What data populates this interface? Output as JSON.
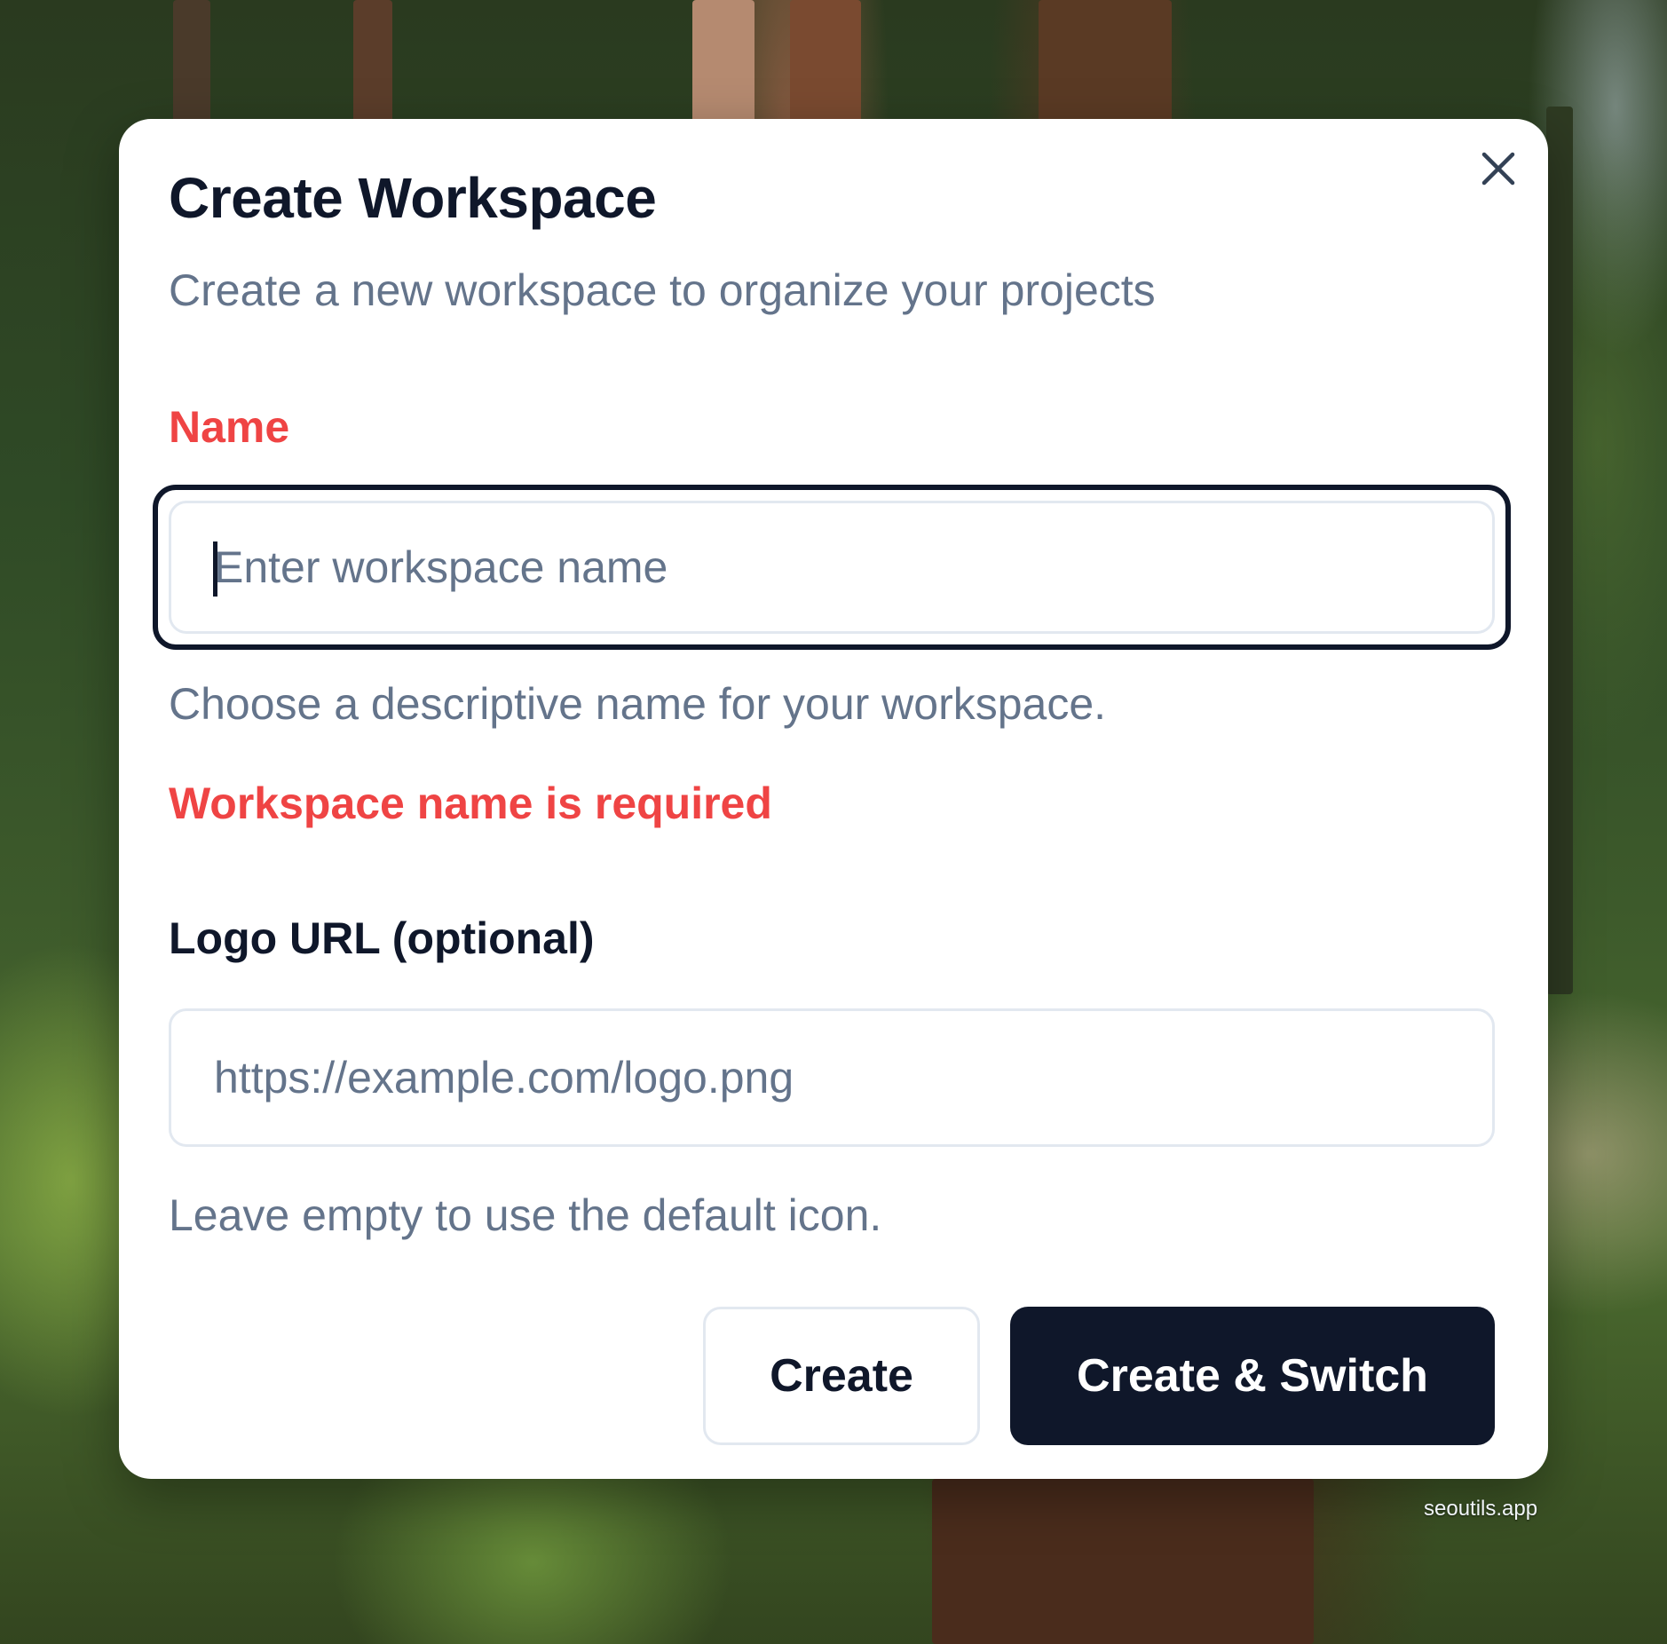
{
  "dialog": {
    "title": "Create Workspace",
    "subtitle": "Create a new workspace to organize your projects",
    "close_icon": "close-icon"
  },
  "name_field": {
    "label": "Name",
    "placeholder": "Enter workspace name",
    "value": "",
    "hint": "Choose a descriptive name for your workspace.",
    "error": "Workspace name is required"
  },
  "logo_field": {
    "label": "Logo URL (optional)",
    "placeholder": "https://example.com/logo.png",
    "value": "",
    "hint": "Leave empty to use the default icon."
  },
  "actions": {
    "create_label": "Create",
    "create_switch_label": "Create & Switch"
  },
  "watermark": "seoutils.app",
  "colors": {
    "primary": "#0f172a",
    "error": "#ef4444",
    "muted": "#64748b",
    "border": "#e2e8f0"
  }
}
